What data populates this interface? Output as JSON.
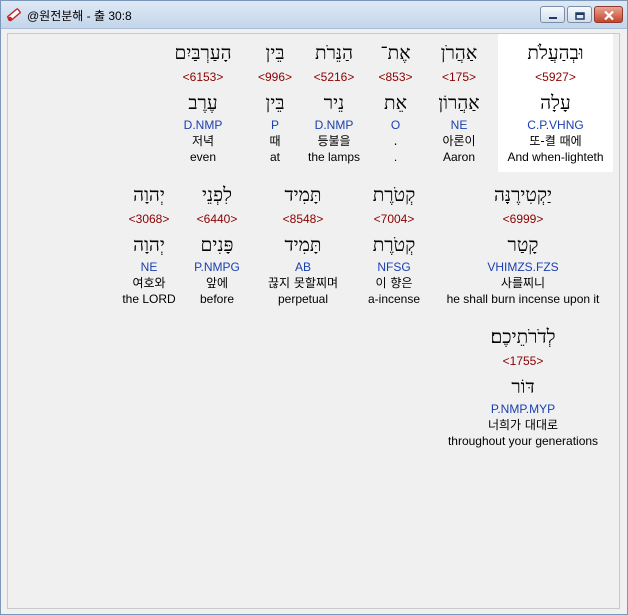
{
  "window": {
    "title": "@원전분해 - 출 30:8"
  },
  "rows": [
    [
      {
        "hebrew": "וּבְהַעֲלֹת",
        "strong": "<5927>",
        "lemma": "עָלָה",
        "parse": "C.P.VHNG",
        "korean": "또-켤 때에",
        "english": "And when-lighteth",
        "highlight": true
      },
      {
        "hebrew": "אַהֲרֹן",
        "strong": "<175>",
        "lemma": "אַהֲרוֹן",
        "parse": "NE",
        "korean": "아론이",
        "english": "Aaron"
      },
      {
        "hebrew": "אֶת־",
        "strong": "<853>",
        "lemma": "אֵת",
        "parse": "O",
        "korean": ".",
        "english": "."
      },
      {
        "hebrew": "הַנֵּרֹת",
        "strong": "<5216>",
        "lemma": "נֵיר",
        "parse": "D.NMP",
        "korean": "등불을",
        "english": "the lamps"
      },
      {
        "hebrew": "בֵּין",
        "strong": "<996>",
        "lemma": "בֵּין",
        "parse": "P",
        "korean": "때",
        "english": "at"
      },
      {
        "hebrew": "הָעַרְבַּיִם",
        "strong": "<6153>",
        "lemma": "עֶרֶב",
        "parse": "D.NMP",
        "korean": "저녁",
        "english": "even"
      }
    ],
    [
      {
        "hebrew": "יַקְטִירֶנָּה",
        "strong": "<6999>",
        "lemma": "קָטַר",
        "parse": "VHIMZS.FZS",
        "korean": "사를찌니",
        "english": "he shall burn incense upon it"
      },
      {
        "hebrew": "קְטֹרֶת",
        "strong": "<7004>",
        "lemma": "קְטֹרֶת",
        "parse": "NFSG",
        "korean": "이 향은",
        "english": "a-incense"
      },
      {
        "hebrew": "תָּמִיד",
        "strong": "<8548>",
        "lemma": "תָּמִיד",
        "parse": "AB",
        "korean": "끊지 못할찌며",
        "english": "perpetual"
      },
      {
        "hebrew": "לִפְנֵי",
        "strong": "<6440>",
        "lemma": "פָּנִים",
        "parse": "P.NMPG",
        "korean": "앞에",
        "english": "before"
      },
      {
        "hebrew": "יְהוָה",
        "strong": "<3068>",
        "lemma": "יְהוָה",
        "parse": "NE",
        "korean": "여호와",
        "english": "the LORD"
      }
    ],
    [
      {
        "hebrew": "לְדֹרֹתֵיכֶם׃",
        "strong": "<1755>",
        "lemma": "דּוֹר",
        "parse": "P.NMP.MYP",
        "korean": "너희가 대대로",
        "english": "throughout your generations"
      }
    ]
  ],
  "colors": {
    "strong_number": "#8b0000",
    "parse_code": "#1a3fb0",
    "highlight_bg": "#ffffff"
  }
}
